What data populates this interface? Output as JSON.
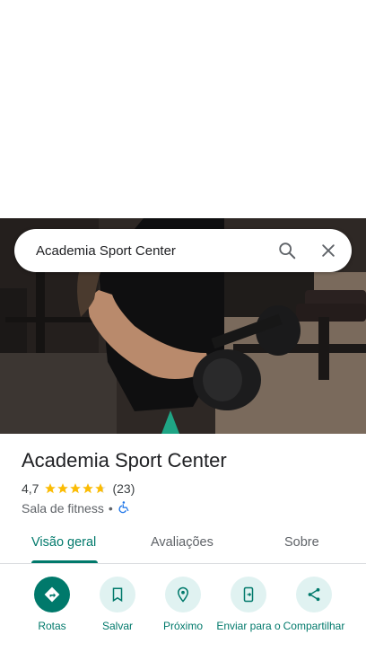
{
  "search": {
    "query": "Academia Sport Center"
  },
  "place": {
    "name": "Academia Sport Center",
    "rating": "4,7",
    "rating_value": 4.7,
    "reviews_count": "(23)",
    "category": "Sala de fitness",
    "separator": "•"
  },
  "tabs": [
    {
      "label": "Visão geral",
      "active": true
    },
    {
      "label": "Avaliações",
      "active": false
    },
    {
      "label": "Sobre",
      "active": false
    }
  ],
  "actions": [
    {
      "label": "Rotas",
      "icon": "directions-icon"
    },
    {
      "label": "Salvar",
      "icon": "bookmark-icon"
    },
    {
      "label": "Próximo",
      "icon": "nearby-icon"
    },
    {
      "label": "Enviar para o",
      "icon": "send-to-phone-icon"
    },
    {
      "label": "Compartilhar",
      "icon": "share-icon"
    }
  ],
  "colors": {
    "accent": "#00796b",
    "accent_light": "#e0f2f1",
    "star": "#fbbc04"
  }
}
